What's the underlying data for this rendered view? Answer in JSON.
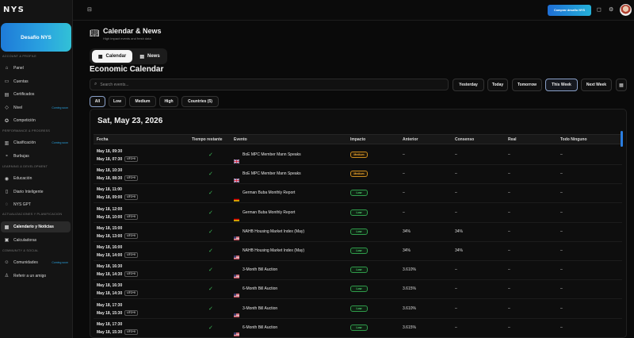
{
  "sidebar": {
    "logo": "NYS",
    "promo_label": "Desafío NYS",
    "sections": [
      {
        "title": "ACCOUNT & PROFILE",
        "items": [
          {
            "label": "Panel",
            "icon": "home-icon",
            "glyph": "⌂"
          },
          {
            "label": "Cuentas",
            "icon": "wallet-icon",
            "glyph": "▭"
          },
          {
            "label": "Certificados",
            "icon": "certificate-icon",
            "glyph": "▤"
          },
          {
            "label": "Nivel",
            "icon": "level-icon",
            "glyph": "◇",
            "soon": "Coming soon"
          },
          {
            "label": "Competición",
            "icon": "trophy-icon",
            "glyph": "✪"
          }
        ]
      },
      {
        "title": "PERFORMANCE & PROGRESS",
        "items": [
          {
            "label": "Clasificación",
            "icon": "ranking-icon",
            "glyph": "▥",
            "soon": "Coming soon"
          },
          {
            "label": "Burbujas",
            "icon": "bubbles-icon",
            "glyph": "∘"
          }
        ]
      },
      {
        "title": "LEARNING & DEVELOPMENT",
        "items": [
          {
            "label": "Educación",
            "icon": "education-icon",
            "glyph": "◉"
          },
          {
            "label": "Diario Inteligente",
            "icon": "journal-icon",
            "glyph": "▯"
          },
          {
            "label": "NYS GPT",
            "icon": "ai-icon",
            "glyph": "◌"
          }
        ]
      },
      {
        "title": "ACTUALIZACIONES Y PLANIFICACION",
        "items": [
          {
            "label": "Calendario y Noticias",
            "icon": "calendar-icon",
            "glyph": "▦",
            "active": true
          },
          {
            "label": "Calculadoras",
            "icon": "calculator-icon",
            "glyph": "▣"
          }
        ]
      },
      {
        "title": "COMMUNITY & SOCIAL",
        "items": [
          {
            "label": "Comunidades",
            "icon": "community-icon",
            "glyph": "☺",
            "soon": "Coming soon"
          },
          {
            "label": "Referir a un amigo",
            "icon": "refer-icon",
            "glyph": "♙"
          }
        ]
      }
    ]
  },
  "topbar": {
    "cta_label": "Comprar desafío NYS"
  },
  "header": {
    "title": "Calendar & News",
    "subtitle": "High impact events and fresh data",
    "tab_calendar": "Calendar",
    "tab_news": "News"
  },
  "economic": {
    "title": "Economic Calendar",
    "search_placeholder": "Search events...",
    "ranges": [
      "Yesterday",
      "Today",
      "Tomorrow",
      "This Week",
      "Next Week"
    ],
    "range_selected": "This Week",
    "filters": [
      "All",
      "Low",
      "Medium",
      "High",
      "Countries (5)"
    ],
    "filter_selected": "All"
  },
  "table": {
    "date_heading": "Sat, May 23, 2026",
    "columns": [
      "Fecha",
      "Tiempo restante",
      "Evento",
      "Impacto",
      "Anterior",
      "Consenso",
      "Real",
      "Todo Ninguno"
    ],
    "utc_label": "UTC+0",
    "rows": [
      {
        "d1": "May 18, 09:30",
        "d2": "May 18, 07:30",
        "flag": "uk",
        "event": "BoE MPC Member Mann Speaks",
        "impact": "Medium",
        "prev": "–",
        "cons": "–",
        "real": "–",
        "all": "–"
      },
      {
        "d1": "May 18, 10:30",
        "d2": "May 18, 08:30",
        "flag": "uk",
        "event": "BoE MPC Member Mann Speaks",
        "impact": "Medium",
        "prev": "–",
        "cons": "–",
        "real": "–",
        "all": "–"
      },
      {
        "d1": "May 18, 11:00",
        "d2": "May 18, 09:00",
        "flag": "de",
        "event": "German Buba Monthly Report",
        "impact": "Low",
        "prev": "–",
        "cons": "–",
        "real": "–",
        "all": "–"
      },
      {
        "d1": "May 18, 12:00",
        "d2": "May 18, 10:00",
        "flag": "de",
        "event": "German Buba Monthly Report",
        "impact": "Low",
        "prev": "–",
        "cons": "–",
        "real": "–",
        "all": "–"
      },
      {
        "d1": "May 18, 15:00",
        "d2": "May 18, 13:00",
        "flag": "us",
        "event": "NAHB Housing Market Index (May)",
        "impact": "Low",
        "prev": "34%",
        "cons": "34%",
        "real": "–",
        "all": "–"
      },
      {
        "d1": "May 18, 16:00",
        "d2": "May 18, 14:00",
        "flag": "us",
        "event": "NAHB Housing Market Index (May)",
        "impact": "Low",
        "prev": "34%",
        "cons": "34%",
        "real": "–",
        "all": "–"
      },
      {
        "d1": "May 18, 16:30",
        "d2": "May 18, 14:30",
        "flag": "us",
        "event": "3-Month Bill Auction",
        "impact": "Low",
        "prev": "3.610%",
        "cons": "–",
        "real": "–",
        "all": "–"
      },
      {
        "d1": "May 18, 16:30",
        "d2": "May 18, 14:30",
        "flag": "us",
        "event": "6-Month Bill Auction",
        "impact": "Low",
        "prev": "3.615%",
        "cons": "–",
        "real": "–",
        "all": "–"
      },
      {
        "d1": "May 18, 17:30",
        "d2": "May 18, 15:30",
        "flag": "us",
        "event": "3-Month Bill Auction",
        "impact": "Low",
        "prev": "3.610%",
        "cons": "–",
        "real": "–",
        "all": "–"
      },
      {
        "d1": "May 18, 17:30",
        "d2": "May 18, 15:30",
        "flag": "us",
        "event": "6-Month Bill Auction",
        "impact": "Low",
        "prev": "3.615%",
        "cons": "–",
        "real": "–",
        "all": "–"
      }
    ]
  },
  "colors": {
    "accent": "#2aa3e0",
    "low": "#4fd070",
    "medium": "#f0a830",
    "check": "#3fbf5a"
  }
}
